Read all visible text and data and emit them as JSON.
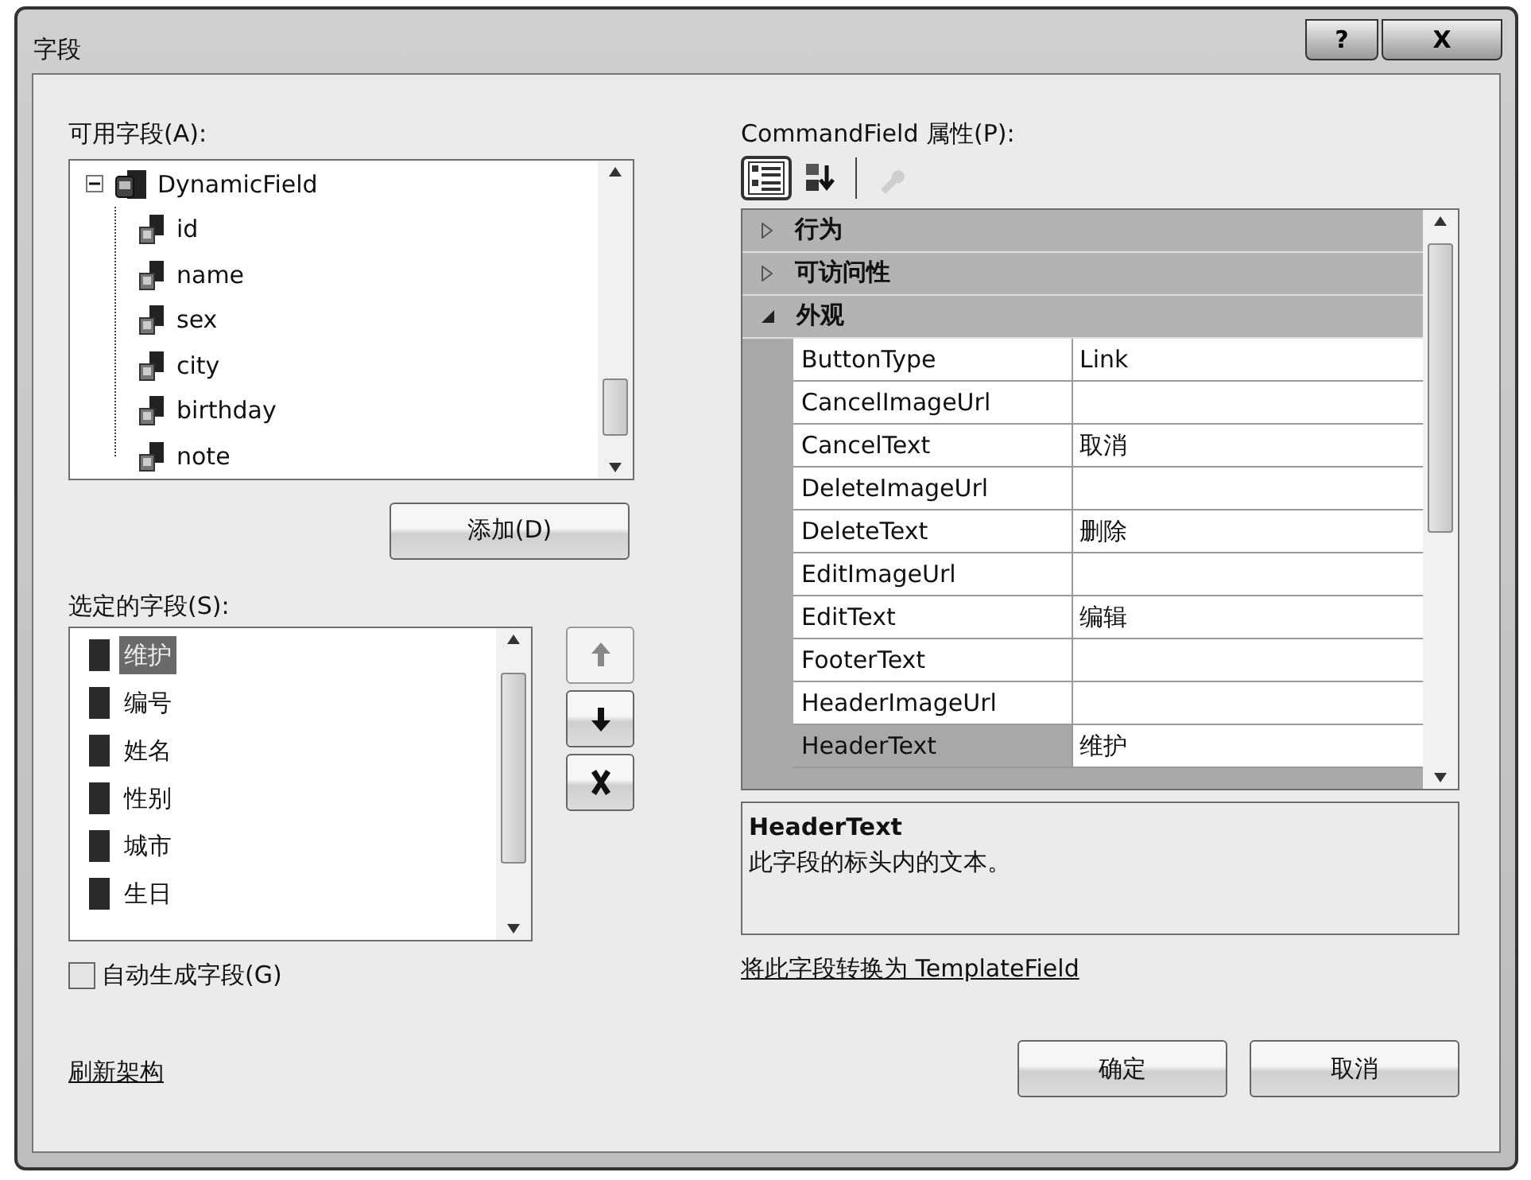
{
  "window": {
    "title": "字段",
    "help_button": "?",
    "close_button": "X"
  },
  "available_fields": {
    "label": "可用字段(A):",
    "tree": [
      {
        "label": "DynamicField",
        "expanded": true,
        "children": [
          {
            "label": "id"
          },
          {
            "label": "name"
          },
          {
            "label": "sex"
          },
          {
            "label": "city"
          },
          {
            "label": "birthday"
          },
          {
            "label": "note"
          }
        ]
      }
    ]
  },
  "add_button": "添加(D)",
  "selected_fields": {
    "label": "选定的字段(S):",
    "items": [
      {
        "label": "维护",
        "selected": true
      },
      {
        "label": "编号",
        "selected": false
      },
      {
        "label": "姓名",
        "selected": false
      },
      {
        "label": "性别",
        "selected": false
      },
      {
        "label": "城市",
        "selected": false
      },
      {
        "label": "生日",
        "selected": false
      }
    ]
  },
  "move_buttons": [
    {
      "kind": "up",
      "disabled": true
    },
    {
      "kind": "down",
      "disabled": false
    },
    {
      "kind": "delete",
      "disabled": false
    }
  ],
  "auto_generate": {
    "label": "自动生成字段(G)",
    "checked": false
  },
  "refresh_link": "刷新架构",
  "properties": {
    "label": "CommandField 属性(P):",
    "toolbar": [
      {
        "kind": "categorized",
        "selected": true,
        "disabled": false
      },
      {
        "kind": "alphabetical",
        "selected": false,
        "disabled": false
      },
      {
        "kind": "property-pages",
        "selected": false,
        "disabled": true
      }
    ],
    "categories": [
      {
        "label": "行为",
        "expanded": false
      },
      {
        "label": "可访问性",
        "expanded": false
      },
      {
        "label": "外观",
        "expanded": true,
        "rows": [
          {
            "name": "ButtonType",
            "value": "Link",
            "selected": false
          },
          {
            "name": "CancelImageUrl",
            "selected": false
          },
          {
            "name": "CancelText",
            "value": "取消",
            "selected": false
          },
          {
            "name": "DeleteImageUrl",
            "selected": false
          },
          {
            "name": "DeleteText",
            "value": "删除",
            "selected": false
          },
          {
            "name": "EditImageUrl",
            "selected": false
          },
          {
            "name": "EditText",
            "value": "编辑",
            "selected": false
          },
          {
            "name": "FooterText",
            "selected": false
          },
          {
            "name": "HeaderImageUrl",
            "selected": false
          },
          {
            "name": "HeaderText",
            "value": "维护",
            "selected": true
          }
        ]
      }
    ]
  },
  "description": {
    "title": "HeaderText",
    "text": "此字段的标头内的文本。"
  },
  "convert_link": "将此字段转换为 TemplateField",
  "buttons": [
    "确定",
    "取消"
  ]
}
